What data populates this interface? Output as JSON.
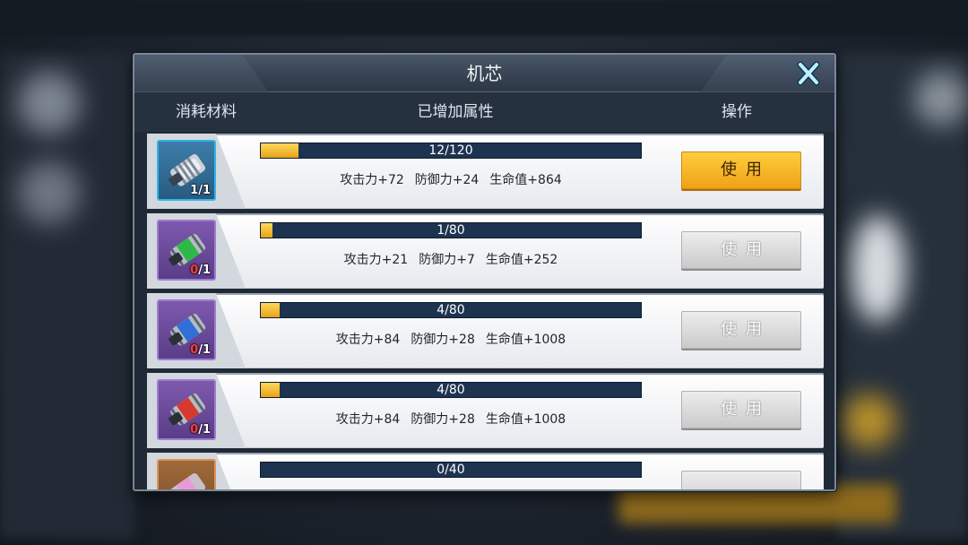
{
  "dialog": {
    "title": "机芯",
    "close_icon": "close-x-icon",
    "columns": {
      "material": "消耗材料",
      "attributes": "已增加属性",
      "action": "操作"
    },
    "rows": [
      {
        "icon": "blue-core-icon",
        "have": "1",
        "need": "/1",
        "progress_text": "12/120",
        "progress": 0.1,
        "attrs": [
          "攻击力+72",
          "防御力+24",
          "生命值+864"
        ],
        "button": "使用",
        "button_state": "active"
      },
      {
        "icon": "green-core-icon",
        "have": "0",
        "need": "/1",
        "progress_text": "1/80",
        "progress": 0.0125,
        "attrs": [
          "攻击力+21",
          "防御力+7",
          "生命值+252"
        ],
        "button": "使用",
        "button_state": "disabled"
      },
      {
        "icon": "blue-core-icon",
        "have": "0",
        "need": "/1",
        "progress_text": "4/80",
        "progress": 0.05,
        "attrs": [
          "攻击力+84",
          "防御力+28",
          "生命值+1008"
        ],
        "button": "使用",
        "button_state": "disabled"
      },
      {
        "icon": "red-core-icon",
        "have": "0",
        "need": "/1",
        "progress_text": "4/80",
        "progress": 0.05,
        "attrs": [
          "攻击力+84",
          "防御力+28",
          "生命值+1008"
        ],
        "button": "使用",
        "button_state": "disabled"
      },
      {
        "icon": "pink-core-icon",
        "progress_text": "0/40",
        "progress": 0
      }
    ]
  },
  "colors": {
    "progress_fill": "#f0b020",
    "progress_track": "#1d3350",
    "button_active": "#f8b82a",
    "button_disabled": "#d6d6d6",
    "count_zero": "#ff3b3b",
    "close_icon": "#9fe0ff"
  }
}
